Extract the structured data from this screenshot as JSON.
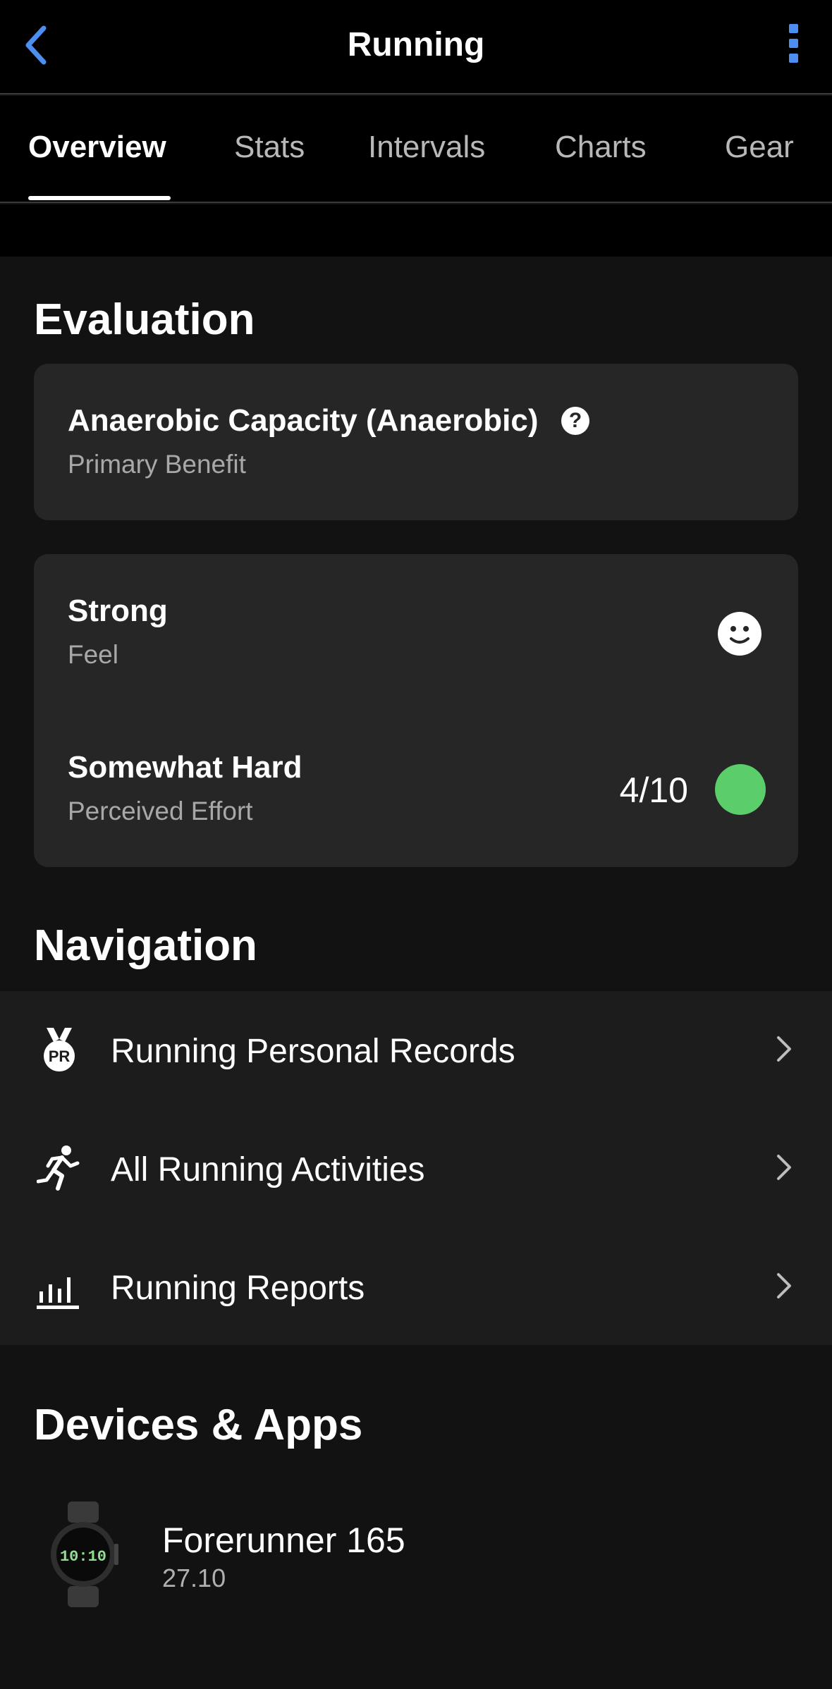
{
  "header": {
    "title": "Running",
    "back_icon": "chevron-left-icon",
    "more_icon": "more-vertical-icon",
    "accent_color": "#4d8ff0"
  },
  "tabs": [
    {
      "label": "Overview",
      "active": true
    },
    {
      "label": "Stats",
      "active": false
    },
    {
      "label": "Intervals",
      "active": false
    },
    {
      "label": "Charts",
      "active": false
    },
    {
      "label": "Gear",
      "active": false
    }
  ],
  "evaluation": {
    "section_title": "Evaluation",
    "primary_benefit": {
      "value": "Anaerobic Capacity (Anaerobic)",
      "label": "Primary Benefit",
      "help_icon": "help-circle-icon",
      "help_glyph": "?"
    },
    "feel": {
      "value": "Strong",
      "label": "Feel",
      "icon": "smiley-face-icon"
    },
    "perceived_effort": {
      "value": "Somewhat Hard",
      "label": "Perceived Effort",
      "score": "4/10",
      "indicator_color": "#5ccd6b"
    }
  },
  "navigation": {
    "section_title": "Navigation",
    "items": [
      {
        "label": "Running Personal Records",
        "icon": "pr-medal-icon",
        "icon_text": "PR"
      },
      {
        "label": "All Running Activities",
        "icon": "runner-icon"
      },
      {
        "label": "Running Reports",
        "icon": "bar-chart-icon"
      }
    ]
  },
  "devices": {
    "section_title": "Devices & Apps",
    "items": [
      {
        "name": "Forerunner 165",
        "version": "27.10",
        "icon": "watch-icon",
        "watch_face_time": "10:10"
      }
    ]
  }
}
